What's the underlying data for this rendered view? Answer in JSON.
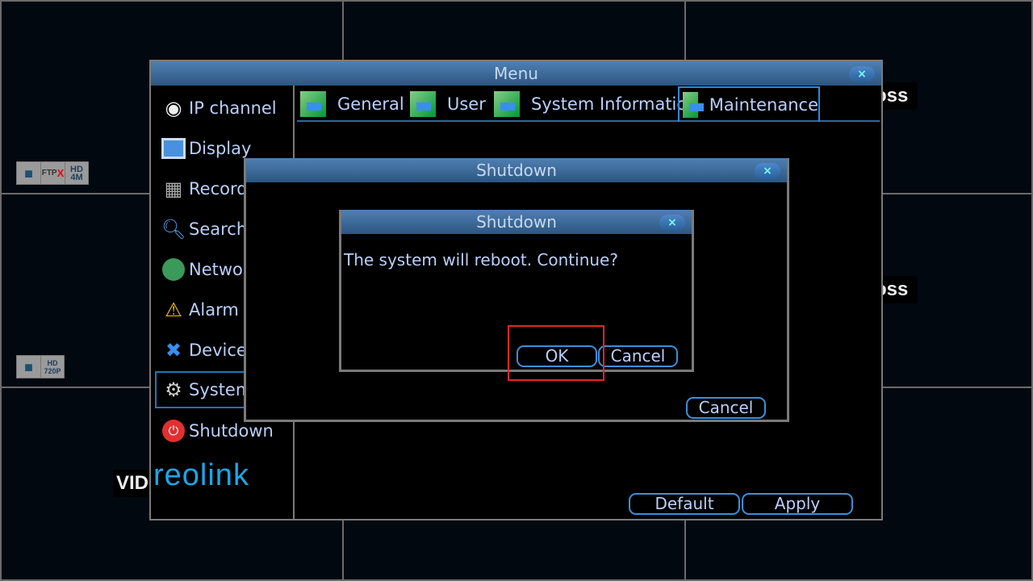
{
  "overlay_tags": [
    "oss",
    "oss",
    "VID"
  ],
  "badges": {
    "ch1": {
      "ftp": "FTP",
      "ftp_x": "X",
      "res": "HD 4M"
    },
    "ch2": {
      "res": "HD 720P"
    }
  },
  "menu": {
    "title": "Menu",
    "close": "×",
    "sidebar": [
      {
        "label": "IP channel",
        "icon": "ip-camera-icon"
      },
      {
        "label": "Display",
        "icon": "display-icon"
      },
      {
        "label": "Recording",
        "icon": "recording-icon"
      },
      {
        "label": "Search",
        "icon": "search-icon"
      },
      {
        "label": "Network",
        "icon": "network-icon"
      },
      {
        "label": "Alarm",
        "icon": "alarm-icon"
      },
      {
        "label": "Device",
        "icon": "device-icon"
      },
      {
        "label": "System",
        "icon": "gear-icon",
        "selected": true
      },
      {
        "label": "Shutdown",
        "icon": "power-icon"
      }
    ],
    "logo": "reolink",
    "tabs": [
      {
        "label": "General"
      },
      {
        "label": "User"
      },
      {
        "label": "System Information"
      },
      {
        "label": "Maintenance",
        "active": true
      }
    ],
    "default_label": "Default",
    "apply_label": "Apply"
  },
  "shutdown_outer": {
    "title": "Shutdown",
    "close": "×",
    "cancel_label": "Cancel"
  },
  "shutdown_confirm": {
    "title": "Shutdown",
    "close": "×",
    "message": "The system will reboot. Continue?",
    "ok_label": "OK",
    "cancel_label": "Cancel"
  },
  "colors": {
    "accent": "#3b8fd8",
    "text": "#b9cffa",
    "highlight": "#e8261c"
  }
}
